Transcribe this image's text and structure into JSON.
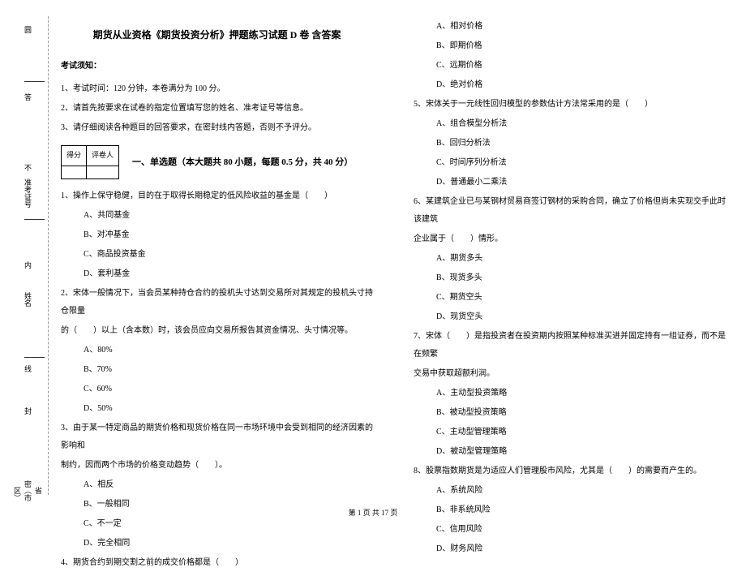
{
  "margin": {
    "l1": "圆",
    "l2": "答",
    "l3": "准考证号",
    "l4": "准",
    "l5": "姓名",
    "l6": "不",
    "l7": "内",
    "l8": "省（市区）",
    "cm1": "线",
    "cm2": "封",
    "cm3": "密",
    "cm4": "密"
  },
  "title": "期货从业资格《期货投资分析》押题练习试题 D 卷  含答案",
  "notice_head": "考试须知：",
  "notices": {
    "n1": "1、考试时间：120 分钟，本卷满分为 100 分。",
    "n2": "2、请首先按要求在试卷的指定位置填写您的姓名、准考证号等信息。",
    "n3": "3、请仔细阅读各种题目的回答要求，在密封线内答题，否则不予评分。"
  },
  "score": {
    "c1": "得分",
    "c2": "评卷人"
  },
  "section1": "一、单选题（本大题共 80 小题，每题 0.5 分，共 40 分）",
  "q1": {
    "stem": "1、操作上保守稳健，目的在于取得长期稳定的低风险收益的基金是（　　）",
    "a": "A、共同基金",
    "b": "B、对冲基金",
    "c": "C、商品投资基金",
    "d": "D、套利基金"
  },
  "q2": {
    "stem1": "2、宋体一般情况下，当会员某种持仓合约的投机头寸达到交易所对其规定的投机头寸持仓限量",
    "stem2": "的（　　）以上（含本数）时，该会员应向交易所报告其资金情况、头寸情况等。",
    "a": "A、80%",
    "b": "B、70%",
    "c": "C、60%",
    "d": "D、50%"
  },
  "q3": {
    "stem1": "3、由于某一特定商品的期货价格和现货价格在同一市场环境中会受到相同的经济因素的影响和",
    "stem2": "制约，因而两个市场的价格变动趋势（　　）。",
    "a": "A、相反",
    "b": "B、一般相同",
    "c": "C、不一定",
    "d": "D、完全相同"
  },
  "q4": {
    "stem": "4、期货合约到期交割之前的成交价格都是（　　）",
    "a": "A、相对价格",
    "b": "B、即期价格",
    "c": "C、远期价格",
    "d": "D、绝对价格"
  },
  "q5": {
    "stem": "5、宋体关于一元线性回归模型的参数估计方法常采用的是（　　）",
    "a": "A、组合模型分析法",
    "b": "B、回归分析法",
    "c": "C、时间序列分析法",
    "d": "D、普通最小二乘法"
  },
  "q6": {
    "stem1": "6、某建筑企业已与某钢材贸易商签订钢材的采购合同，确立了价格但尚未实现交手此时该建筑",
    "stem2": "企业属于（　　）情形。",
    "a": "A、期货多头",
    "b": "B、现货多头",
    "c": "C、期货空头",
    "d": "D、现货空头"
  },
  "q7": {
    "stem1": "7、宋体（　　）是指投资者在投资期内按照某种标准买进并固定持有一组证券，而不是在频繁",
    "stem2": "交易中获取超额利润。",
    "a": "A、主动型投资策略",
    "b": "B、被动型投资策略",
    "c": "C、主动型管理策略",
    "d": "D、被动型管理策略"
  },
  "q8": {
    "stem": "8、股票指数期货是为适应人们管理股市风险，尤其是（　　）的需要而产生的。",
    "a": "A、系统风险",
    "b": "B、非系统风险",
    "c": "C、信用风险",
    "d": "D、财务风险"
  },
  "footer": "第 1 页 共 17 页"
}
